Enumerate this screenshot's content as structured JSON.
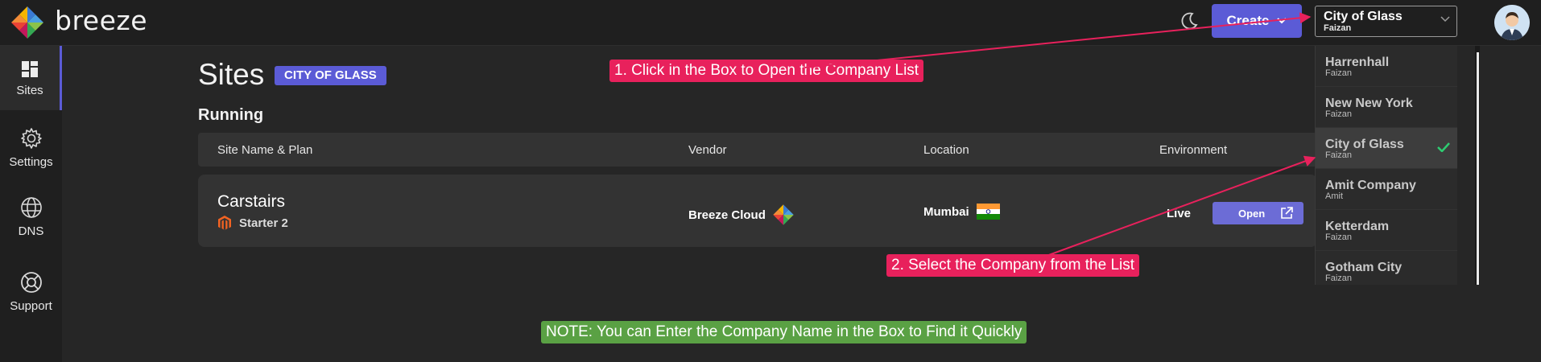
{
  "colors": {
    "accent": "#5b5bd6",
    "annotation_red": "#e8215c",
    "annotation_green": "#5aa144",
    "check_green": "#2ecc71"
  },
  "header": {
    "brand": "breeze",
    "logo_icon": "breeze-pinwheel-logo",
    "theme_icon": "moon-icon",
    "create_label": "Create",
    "company_select": {
      "name": "City of Glass",
      "owner": "Faizan"
    }
  },
  "sidebar": {
    "items": [
      {
        "label": "Sites",
        "icon": "dashboard-grid-icon",
        "active": true
      },
      {
        "label": "Settings",
        "icon": "gear-icon"
      },
      {
        "label": "DNS",
        "icon": "globe-icon"
      },
      {
        "label": "Support",
        "icon": "lifebuoy-icon"
      }
    ]
  },
  "main": {
    "title": "Sites",
    "company_badge": "CITY OF GLASS",
    "section": "Running",
    "columns": [
      "Site Name & Plan",
      "Vendor",
      "Location",
      "Environment"
    ],
    "site": {
      "name": "Carstairs",
      "plan": "Starter 2",
      "vendor": "Breeze Cloud",
      "location": "Mumbai",
      "environment": "Live",
      "open_label": "Open"
    }
  },
  "dropdown": {
    "items": [
      {
        "name": "Harrenhall",
        "owner": "Faizan"
      },
      {
        "name": "New New York",
        "owner": "Faizan"
      },
      {
        "name": "City of Glass",
        "owner": "Faizan",
        "selected": true
      },
      {
        "name": "Amit Company",
        "owner": "Amit"
      },
      {
        "name": "Ketterdam",
        "owner": "Faizan"
      },
      {
        "name": "Gotham City",
        "owner": "Faizan"
      }
    ]
  },
  "annotations": {
    "step1": "1. Click in the Box to Open the Company List",
    "step2": "2. Select the Company from the List",
    "note": "NOTE: You can Enter the Company Name in the Box to Find it Quickly"
  }
}
